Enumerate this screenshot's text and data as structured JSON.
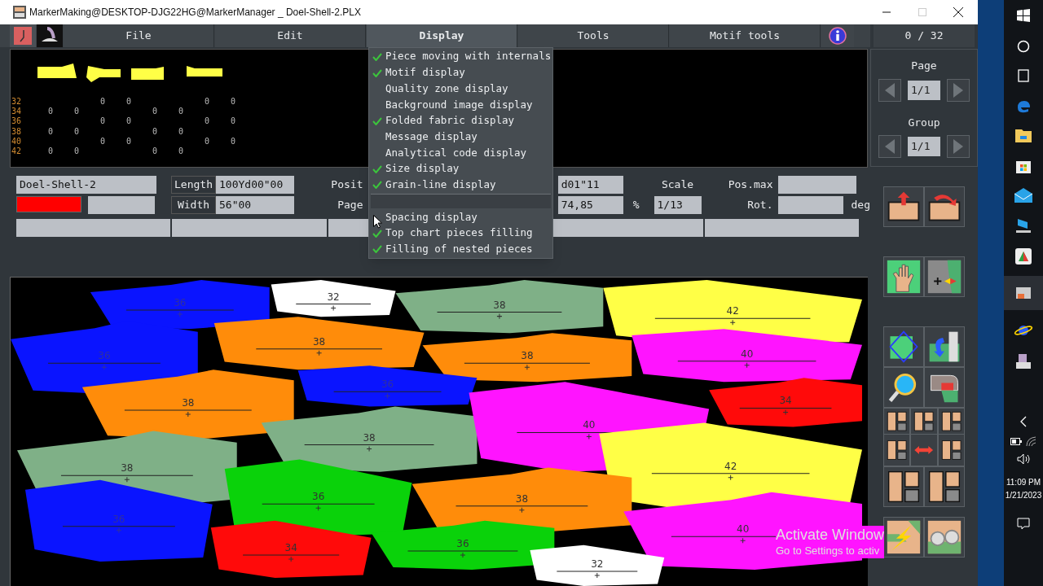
{
  "window": {
    "title": "MarkerMaking@DESKTOP-DJG22HG@MarkerManager _ Doel-Shell-2.PLX"
  },
  "menu": [
    {
      "label": "File",
      "selected": false
    },
    {
      "label": "Edit",
      "selected": false
    },
    {
      "label": "Display",
      "selected": true
    },
    {
      "label": "Tools",
      "selected": false
    },
    {
      "label": "Motif tools",
      "selected": false
    }
  ],
  "display_menu": [
    {
      "label": "Piece moving with internals",
      "checked": true
    },
    {
      "label": "Motif display",
      "checked": true
    },
    {
      "label": "Quality zone display",
      "checked": false
    },
    {
      "label": "Background image display",
      "checked": false
    },
    {
      "label": "Folded fabric display",
      "checked": true
    },
    {
      "label": "Message display",
      "checked": false
    },
    {
      "label": "Analytical code display",
      "checked": false
    },
    {
      "label": "Size display",
      "checked": true
    },
    {
      "label": "Grain-line display",
      "checked": true
    },
    {
      "kind": "separator"
    },
    {
      "label": "Spacing display",
      "checked": false
    },
    {
      "label": "Top chart pieces filling",
      "checked": true
    },
    {
      "label": "Filling of nested pieces",
      "checked": true
    }
  ],
  "size_table": [
    {
      "size": "32",
      "kind": "shifted",
      "counts": [
        "0",
        "0",
        "0",
        "0"
      ]
    },
    {
      "size": "34",
      "kind": "plain",
      "counts": [
        "0",
        "0",
        "0",
        "0"
      ]
    },
    {
      "size": "36",
      "kind": "shifted",
      "counts": [
        "0",
        "0",
        "0",
        "0"
      ]
    },
    {
      "size": "38",
      "kind": "plain",
      "counts": [
        "0",
        "0",
        "0",
        "0"
      ]
    },
    {
      "size": "40",
      "kind": "shifted",
      "counts": [
        "0",
        "0",
        "0",
        "0"
      ]
    },
    {
      "size": "42",
      "kind": "plain",
      "counts": [
        "0",
        "0",
        "0",
        "0"
      ]
    }
  ],
  "marker_info": {
    "name": "Doel-Shell-2",
    "color": "#ff0000",
    "length_label": "Length",
    "length": "100Yd00\"00",
    "width_label": "Width",
    "width": "56\"00",
    "position_label": "Posit",
    "page_label": "Page",
    "position": "d01\"11",
    "efficiency": "74,85",
    "efficiency_unit": "%",
    "scale_label": "Scale",
    "scale": "1/13",
    "pos_max_label": "Pos.max",
    "rotation_label": "Rot.",
    "rotation_unit": "deg"
  },
  "piece_counter": "0 / 32",
  "page": {
    "label": "Page",
    "value": "1/1"
  },
  "group": {
    "label": "Group",
    "value": "1/1"
  },
  "pieces": [
    {
      "size": "36",
      "color": "#0a14ff"
    },
    {
      "size": "32",
      "color": "#ffffff"
    },
    {
      "size": "38",
      "color": "#7fb087"
    },
    {
      "size": "42",
      "color": "#ffff46"
    },
    {
      "size": "36",
      "color": "#0a14ff"
    },
    {
      "size": "38",
      "color": "#ff8c0a"
    },
    {
      "size": "38",
      "color": "#ff8c0a"
    },
    {
      "size": "40",
      "color": "#ff14ff"
    },
    {
      "size": "38",
      "color": "#ff8c0a"
    },
    {
      "size": "36",
      "color": "#0a14ff"
    },
    {
      "size": "38",
      "color": "#7fb087"
    },
    {
      "size": "40",
      "color": "#ff14ff"
    },
    {
      "size": "34",
      "color": "#ff0a0a"
    },
    {
      "size": "42",
      "color": "#ffff46"
    },
    {
      "size": "38",
      "color": "#7fb087"
    },
    {
      "size": "36",
      "color": "#0ad20a"
    },
    {
      "size": "38",
      "color": "#ff8c0a"
    },
    {
      "size": "36",
      "color": "#0a14ff"
    },
    {
      "size": "40",
      "color": "#ff14ff"
    },
    {
      "size": "34",
      "color": "#ff0a0a"
    },
    {
      "size": "36",
      "color": "#0ad20a"
    },
    {
      "size": "32",
      "color": "#ffffff"
    }
  ],
  "desktop": {
    "watermark_title": "Activate Window",
    "watermark_text": "Go to Settings to activ"
  },
  "taskbar": {
    "time": "11:09 PM",
    "date": "1/21/2023"
  }
}
